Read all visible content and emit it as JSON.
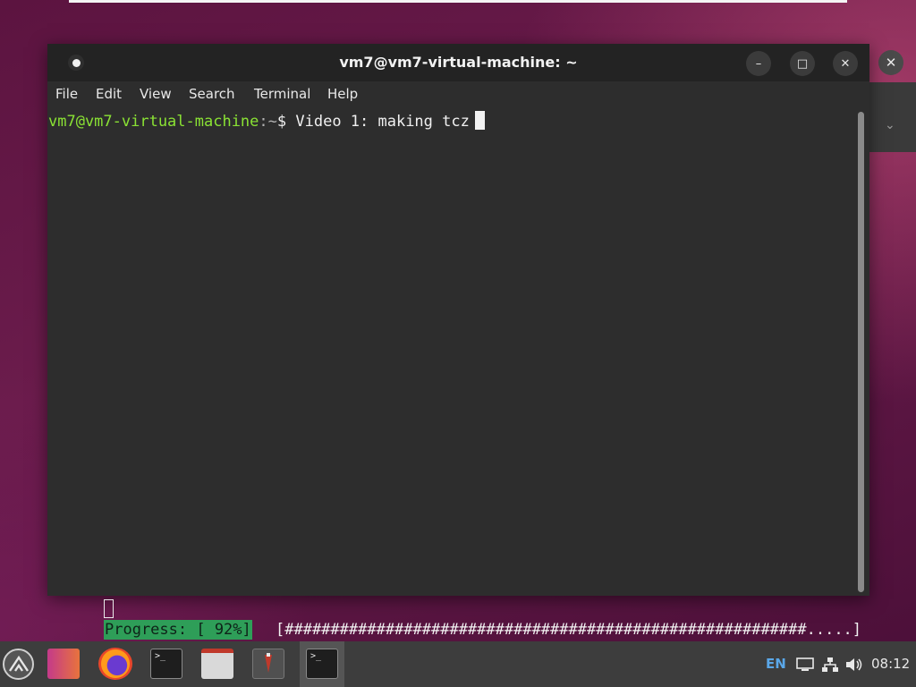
{
  "window": {
    "title": "vm7@vm7-virtual-machine: ~",
    "controls": {
      "minimize": "–",
      "maximize": "□",
      "close": "✕"
    }
  },
  "menu": [
    "File",
    "Edit",
    "View",
    "Search",
    "Terminal",
    "Help"
  ],
  "terminal": {
    "user_host": "vm7@vm7-virtual-machine",
    "path": ":~",
    "prompt_symbol": "$",
    "command": " Video 1: making tcz"
  },
  "background_terminal": {
    "progress_label": "Progress: [ 92%]",
    "progress_percent": 92,
    "progress_bar": "[#########################################################.....]"
  },
  "background_window": {
    "close": "✕",
    "chevron": "⌄"
  },
  "taskbar": {
    "apps": [
      "start-menu-icon",
      "color-palette-icon",
      "firefox-icon",
      "terminal-icon",
      "file-manager-icon",
      "application-icon",
      "terminal-icon"
    ],
    "tray": {
      "lang": "EN",
      "time": "08:12"
    },
    "colors": {
      "accent": "#2e9e58",
      "user_green": "#8ae234",
      "lang_blue": "#5aa7e8"
    }
  }
}
